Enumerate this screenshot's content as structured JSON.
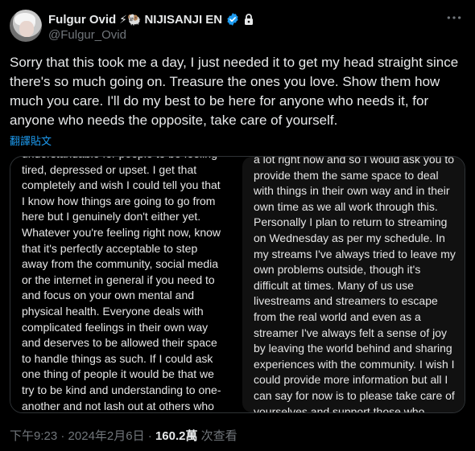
{
  "author": {
    "name": "Fulgur Ovid",
    "name_emojis": "⚡🐏",
    "affiliation": "NIJISANJI EN",
    "handle": "@Fulgur_Ovid"
  },
  "tweet": {
    "text": "Sorry that this took me a day, I just needed it to get my head straight since there's so much going on. Treasure the ones you love. Show them how much you care. I'll do my best to be here for anyone who needs it, for anyone who needs the opposite, take care of yourself.",
    "translate_label": "翻譯貼文"
  },
  "media": {
    "left_text": "understandable for people to be feeling\ntired, depressed or upset. I get that\ncompletely and wish I could tell you that\nI know how things are going to go from\nhere but I genuinely don't either yet.\nWhatever you're feeling right now, know\nthat it's perfectly acceptable to step\naway from the community, social media\nor the internet in general if you need to\nand focus on your own mental and\nphysical health. Everyone deals with\ncomplicated feelings in their own way\nand deserves to be allowed their space\nto handle things as such. If I could ask\none thing of people it would be that we\ntry to be kind and understanding to one-\nanother and not lash out at others who\nare also doing their best to deal with",
    "right_text": "a lot right now and so I would ask you to\nprovide them the same space to deal\nwith things in their own way and in their\nown time as we all work through this.\nPersonally I plan to return to streaming\non Wednesday as per my schedule. In\nmy streams I've always tried to leave my\nown problems outside, though it's\ndifficult at times. Many of us use\nlivestreams and streamers to escape\nfrom the real world and even as a\nstreamer I've always felt a sense of joy\nby leaving the world behind and sharing\nexperiences with the community. I wish I\ncould provide more information but all I\ncan say for now is to please take care of\nyourselves and support those who"
  },
  "meta": {
    "time": "下午9:23",
    "sep1": " · ",
    "date": "2024年2月6日",
    "sep2": " · ",
    "views": "160.2萬",
    "views_label": " 次查看"
  },
  "colors": {
    "background": "#000000",
    "text": "#e7e9ea",
    "muted": "#71767b",
    "link": "#1d9bf0",
    "verified": "#1d9bf0"
  }
}
